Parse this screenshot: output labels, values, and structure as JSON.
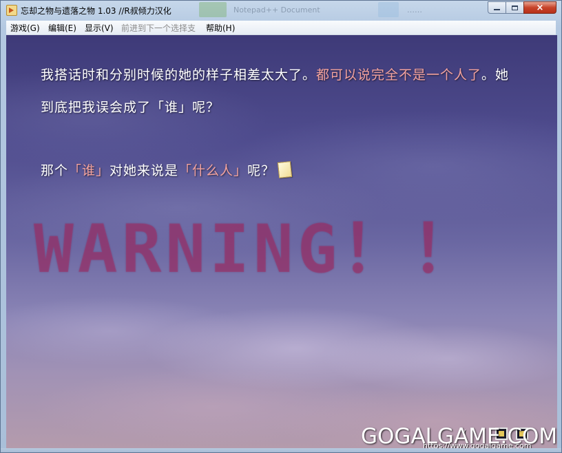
{
  "window": {
    "title": "忘却之物与遗落之物 1.03 //R叔倾力汉化",
    "background_tabs": [
      "Notepad++ Document",
      "……"
    ],
    "buttons": {
      "minimize": "minimize",
      "maximize": "maximize",
      "close": "×"
    }
  },
  "menu": {
    "items": [
      {
        "label": "游戏(G)",
        "enabled": true
      },
      {
        "label": "编辑(E)",
        "enabled": true
      },
      {
        "label": "显示(V)",
        "enabled": true
      },
      {
        "label": "前进到下一个选择支",
        "enabled": false
      },
      {
        "label": "帮助(H)",
        "enabled": true
      }
    ]
  },
  "dialogue": {
    "line1_a": "我搭话时和分别时候的她的样子相差太大了。",
    "line1_b": "都可以说完全不是一个人了",
    "line1_c": "。她",
    "line2": "到底把我误会成了「谁」呢？",
    "line3_a": "那个",
    "line3_b": "「谁」",
    "line3_c": "对她来说是",
    "line3_d": "「什么人」",
    "line3_e": "呢？"
  },
  "overlay": {
    "warning": "WARNING！！"
  },
  "hud": {
    "label": "("
  },
  "watermark": {
    "brand": "GOGALGAME.COM",
    "url": "https://www.gogalgame.com"
  },
  "colors": {
    "highlight_text": "#f4a39e",
    "warning": "#9e3068",
    "sky_top": "#3e3a78",
    "sky_bottom": "#b49bac"
  }
}
